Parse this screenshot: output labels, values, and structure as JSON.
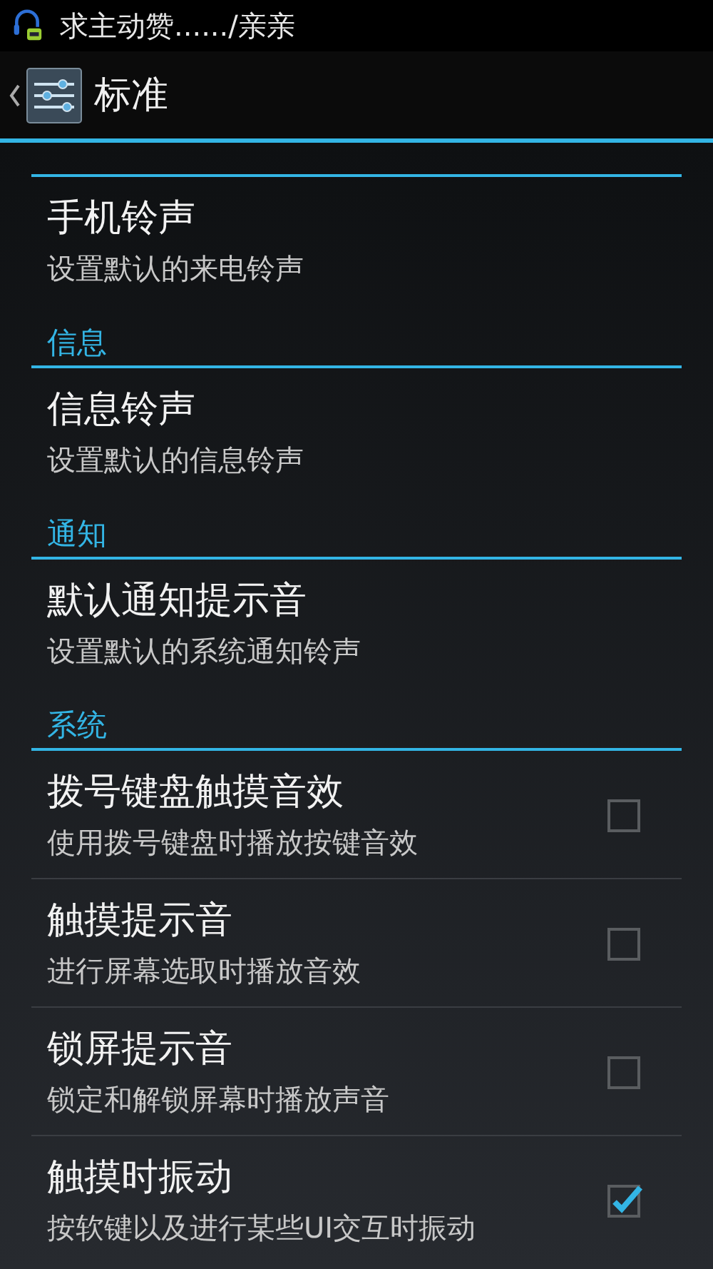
{
  "status_bar": {
    "notification": "求主动赞....../亲亲"
  },
  "header": {
    "title": "标准"
  },
  "groups": [
    {
      "items": [
        {
          "kind": "ringtone",
          "title": "手机铃声",
          "summary": "设置默认的来电铃声"
        }
      ]
    },
    {
      "title": "信息",
      "items": [
        {
          "kind": "ringtone",
          "title": "信息铃声",
          "summary": "设置默认的信息铃声"
        }
      ]
    },
    {
      "title": "通知",
      "items": [
        {
          "kind": "ringtone",
          "title": "默认通知提示音",
          "summary": "设置默认的系统通知铃声"
        }
      ]
    },
    {
      "title": "系统",
      "items": [
        {
          "kind": "checkbox",
          "title": "拨号键盘触摸音效",
          "summary": "使用拨号键盘时播放按键音效",
          "checked": false
        },
        {
          "kind": "checkbox",
          "title": "触摸提示音",
          "summary": "进行屏幕选取时播放音效",
          "checked": false
        },
        {
          "kind": "checkbox",
          "title": "锁屏提示音",
          "summary": "锁定和解锁屏幕时播放声音",
          "checked": false
        },
        {
          "kind": "checkbox",
          "title": "触摸时振动",
          "summary": "按软键以及进行某些UI交互时振动",
          "checked": true
        }
      ]
    }
  ]
}
